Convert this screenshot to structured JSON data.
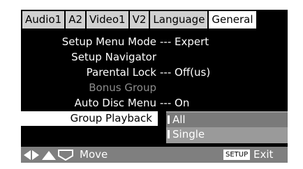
{
  "tabs": [
    {
      "label": "Audio1",
      "active": false
    },
    {
      "label": "A2",
      "active": false
    },
    {
      "label": "Video1",
      "active": false
    },
    {
      "label": "V2",
      "active": false
    },
    {
      "label": "Language",
      "active": false
    },
    {
      "label": "General",
      "active": true
    }
  ],
  "settings": [
    {
      "label": "Setup Menu Mode",
      "value": "--- Expert",
      "state": "normal"
    },
    {
      "label": "Setup Navigator",
      "value": "",
      "state": "normal"
    },
    {
      "label": "Parental Lock",
      "value": "--- Off(us)",
      "state": "normal"
    },
    {
      "label": "Bonus Group",
      "value": "",
      "state": "disabled"
    },
    {
      "label": "Auto Disc Menu",
      "value": "--- On",
      "state": "normal"
    },
    {
      "label": "Group Playback",
      "value": "",
      "state": "selected"
    }
  ],
  "dropdown": {
    "options": [
      "All",
      "Single"
    ],
    "highlighted": "All"
  },
  "footer": {
    "nav_icons": [
      "left-arrow-icon",
      "right-arrow-icon",
      "up-arrow-icon",
      "down-arrow-icon"
    ],
    "move_label": "Move",
    "setup_key": "SETUP",
    "exit_label": "Exit"
  },
  "colors": {
    "background": "#000000",
    "tab_inactive": "#d0d0d0",
    "tab_active": "#ffffff",
    "disabled_text": "#8c8c8c",
    "footer_bar": "#7f7f7f",
    "dropdown_bg": "#9a9a9a"
  }
}
